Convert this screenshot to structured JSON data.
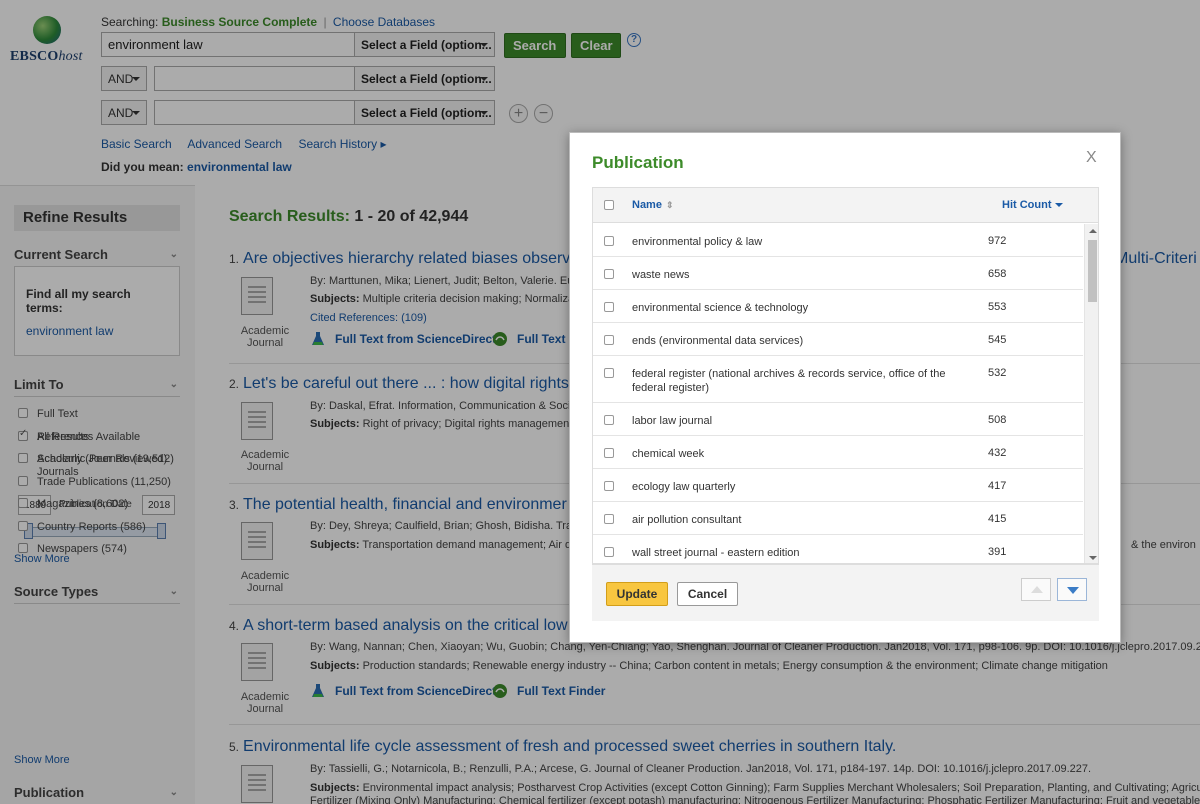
{
  "logo": {
    "main": "EBSCO",
    "suffix": "host"
  },
  "search": {
    "searching_label": "Searching:",
    "database": "Business Source Complete",
    "choose_databases": "Choose Databases",
    "query": "environment law",
    "field_placeholder": "Select a Field (option...",
    "op1": "AND",
    "op2": "AND",
    "search_btn": "Search",
    "clear_btn": "Clear",
    "help": "?",
    "links": [
      "Basic Search",
      "Advanced Search",
      "Search History ▸"
    ],
    "did_you_mean_label": "Did you mean:",
    "did_you_mean_value": "environmental law"
  },
  "sidebar": {
    "refine": "Refine Results",
    "current_search": "Current Search",
    "find_all": "Find all my search terms:",
    "term": "environment law",
    "limit_to": "Limit To",
    "limits": [
      "Full Text",
      "References Available",
      "Scholarly (Peer Reviewed) Journals"
    ],
    "date_from": "1889",
    "date_label": "Publication Date",
    "date_to": "2018",
    "date_range_selected": [
      0,
      1
    ],
    "show_more": "Show More",
    "source_types": "Source Types",
    "sources": [
      {
        "label": "All Results",
        "checked": true
      },
      {
        "label": "Academic Journals (19,512)",
        "checked": false
      },
      {
        "label": "Trade Publications (11,250)",
        "checked": false
      },
      {
        "label": "Magazines (8,602)",
        "checked": false
      },
      {
        "label": "Country Reports (586)",
        "checked": false
      },
      {
        "label": "Newspapers (574)",
        "checked": false
      }
    ],
    "show_more2": "Show More",
    "publication": "Publication"
  },
  "results": {
    "label": "Search Results:",
    "range": "1 - 20 of 42,944",
    "doc_label": "Academic Journal",
    "items": [
      {
        "num": "1.",
        "title": "Are objectives hierarchy related biases observ",
        "title_right": "Multi-Criteri",
        "meta": "By: Marttunen, Mika; Lienert, Judit; Belton, Valerie. Eu",
        "subjects_label": "Subjects:",
        "subjects": "Multiple criteria decision making; Normaliza",
        "cited": "Cited References: (109)",
        "ft1": "Full Text from ScienceDirect",
        "ft2": "Full Text F"
      },
      {
        "num": "2.",
        "title": "Let's be careful out there ... : how digital rights",
        "meta": "By: Daskal, Efrat. Information, Communication & Socie",
        "subjects_label": "Subjects:",
        "subjects": "Right of privacy; Digital rights management;"
      },
      {
        "num": "3.",
        "title": "The potential health, financial and environmer",
        "meta": "By: Dey, Shreya; Caulfield, Brian; Ghosh, Bidisha. Tra",
        "subjects_label": "Subjects:",
        "subjects": "Transportation demand management; Air qu",
        "subjects_right": "& the environ"
      },
      {
        "num": "4.",
        "title": "A short-term based analysis on the critical low",
        "meta": "By: Wang, Nannan; Chen, Xiaoyan; Wu, Guobin; Chang, Yen-Chiang; Yao, Shenghan. Journal of Cleaner Production. Jan2018, Vol. 171, p98-106. 9p. DOI: 10.1016/j.jclepro.2017.09.261.",
        "subjects_label": "Subjects:",
        "subjects": "Production standards; Renewable energy industry -- China; Carbon content in metals; Energy consumption & the environment; Climate change mitigation",
        "ft1": "Full Text from ScienceDirect",
        "ft2": "Full Text Finder"
      },
      {
        "num": "5.",
        "title": "Environmental life cycle assessment of fresh and processed sweet cherries in southern Italy.",
        "meta": "By: Tassielli, G.; Notarnicola, B.; Renzulli, P.A.; Arcese, G. Journal of Cleaner Production. Jan2018, Vol. 171, p184-197. 14p. DOI: 10.1016/j.jclepro.2017.09.227.",
        "subjects_label": "Subjects:",
        "subjects": "Environmental impact analysis; Postharvest Crop Activities (except Cotton Ginning); Farm Supplies Merchant Wholesalers; Soil Preparation, Planting, and Cultivating; Agricultural",
        "subjects2": "Fertilizer (Mixing Only) Manufacturing; Chemical fertilizer (except potash) manufacturing; Nitrogenous Fertilizer Manufacturing; Phosphatic Fertilizer Manufacturing; Fruit and vegetable ca"
      }
    ]
  },
  "modal": {
    "title": "Publication",
    "close": "X",
    "col_name": "Name",
    "col_hits": "Hit Count",
    "rows": [
      {
        "name": "environmental policy & law",
        "count": "972"
      },
      {
        "name": "waste news",
        "count": "658"
      },
      {
        "name": "environmental science & technology",
        "count": "553"
      },
      {
        "name": "ends (environmental data services)",
        "count": "545"
      },
      {
        "name": "federal register (national archives & records service, office of the federal register)",
        "count": "532"
      },
      {
        "name": "labor law journal",
        "count": "508"
      },
      {
        "name": "chemical week",
        "count": "432"
      },
      {
        "name": "ecology law quarterly",
        "count": "417"
      },
      {
        "name": "air pollution consultant",
        "count": "415"
      },
      {
        "name": "wall street journal - eastern edition",
        "count": "391"
      }
    ],
    "update": "Update",
    "cancel": "Cancel"
  }
}
